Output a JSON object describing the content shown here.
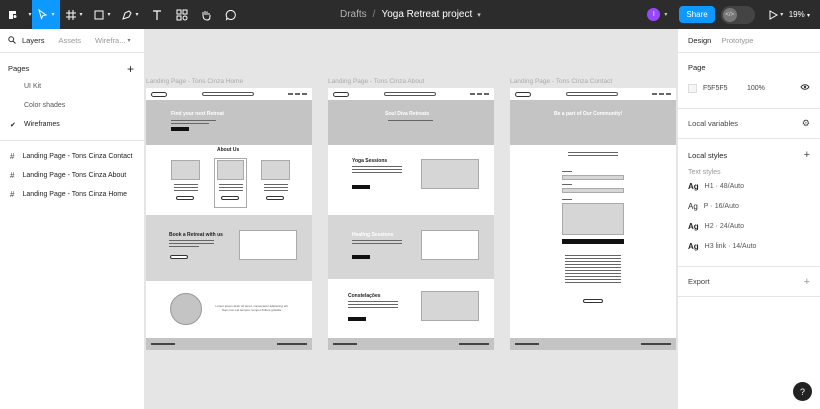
{
  "toolbar": {
    "breadcrumb_root": "Drafts",
    "breadcrumb_sep": "/",
    "project_name": "Yoga Retreat project",
    "avatar_initial": "I",
    "share_label": "Share",
    "zoom_level": "19%"
  },
  "left_panel": {
    "tabs": [
      "Layers",
      "Assets",
      "Wirefra..."
    ],
    "pages_heading": "Pages",
    "pages": [
      "UI Kit",
      "Color shades",
      "Wireframes"
    ],
    "layers": [
      "Landing Page - Tons Cinza Contact",
      "Landing Page - Tons Cinza About",
      "Landing Page - Tons Cinza Home"
    ]
  },
  "canvas": {
    "frames": [
      {
        "title": "Landing Page - Tons Cinza Home",
        "hero_heading": "Find your next Retreat",
        "section1_heading": "About Us",
        "section2_heading": "Book a Retreat with us",
        "section3_text": "Lorem ipsum dolor sit amet, consectetur adipiscing elit. Nam non est tempus, tempor finibus gravida."
      },
      {
        "title": "Landing Page - Tons Cinza About",
        "hero_heading": "Soul Diva Retreats",
        "section1_heading": "Yoga Sessions",
        "section2_heading": "Healing Sessions",
        "section3_heading": "Constelações"
      },
      {
        "title": "Landing Page - Tons Cinza Contact",
        "hero_heading": "Be a part of Our Community!"
      }
    ]
  },
  "right_panel": {
    "tabs": [
      "Design",
      "Prototype"
    ],
    "page_heading": "Page",
    "page_color": "F5F5F5",
    "page_opacity": "100%",
    "local_variables": "Local variables",
    "local_styles": "Local styles",
    "text_styles_label": "Text styles",
    "text_styles": [
      {
        "name": "H1",
        "spec": "48/Auto"
      },
      {
        "name": "P",
        "spec": "16/Auto"
      },
      {
        "name": "H2",
        "spec": "24/Auto"
      },
      {
        "name": "H3 link",
        "spec": "14/Auto"
      }
    ],
    "export_label": "Export"
  },
  "help_label": "?"
}
